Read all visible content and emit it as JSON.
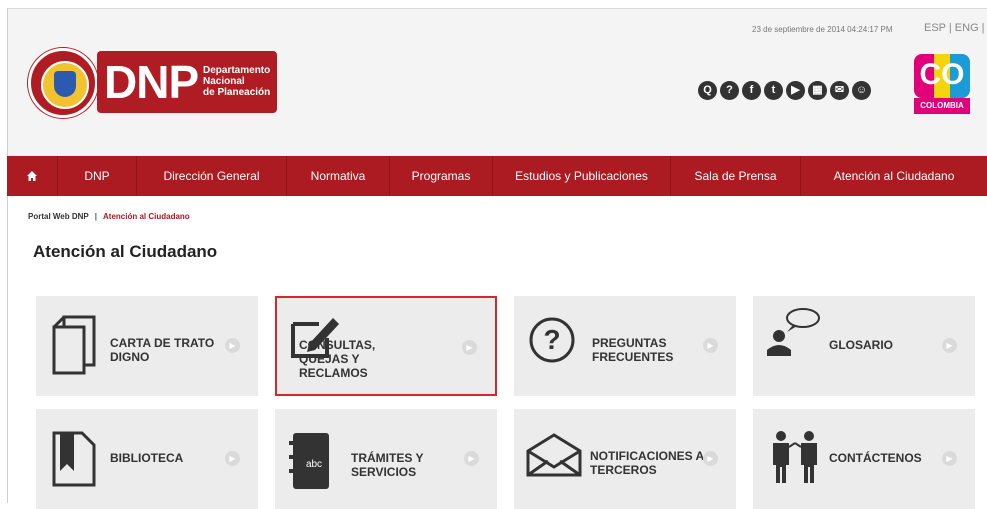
{
  "header": {
    "logo_abbr": "DNP",
    "logo_name": "Departamento\nNacional\nde Planeación",
    "timestamp": "23 de septiembre de 2014 04:24:17 PM",
    "language": "ESP | ENG |",
    "country_logo": "CO",
    "country_word": "COLOMBIA",
    "social_icons": [
      {
        "name": "search-icon",
        "glyph": "Q"
      },
      {
        "name": "help-icon",
        "glyph": "?"
      },
      {
        "name": "facebook-icon",
        "glyph": "f"
      },
      {
        "name": "twitter-icon",
        "glyph": "t"
      },
      {
        "name": "youtube-icon",
        "glyph": "▶"
      },
      {
        "name": "sitemap-icon",
        "glyph": "▦"
      },
      {
        "name": "mail-icon",
        "glyph": "✉"
      },
      {
        "name": "community-icon",
        "glyph": "☺"
      }
    ]
  },
  "nav": {
    "home_icon": "home-icon",
    "items": [
      "DNP",
      "Dirección General",
      "Normativa",
      "Programas",
      "Estudios y Publicaciones",
      "Sala de Prensa",
      "Atención al Ciudadano"
    ]
  },
  "breadcrumb": {
    "root": "Portal Web DNP",
    "separator": "|",
    "current": "Atención al Ciudadano"
  },
  "page_title": "Atención al Ciudadano",
  "cards": [
    {
      "label": "CARTA DE TRATO\nDIGNO",
      "icon": "documents-icon"
    },
    {
      "label": "CONSULTAS,\n        QUEJAS Y\nRECLAMOS",
      "icon": "edit-icon",
      "active": true
    },
    {
      "label": "PREGUNTAS\nFRECUENTES",
      "icon": "question-icon"
    },
    {
      "label": "GLOSARIO",
      "icon": "speech-person-icon"
    },
    {
      "label": "BIBLIOTECA",
      "icon": "bookmark-icon"
    },
    {
      "label": "TRÁMITES Y\nSERVICIOS",
      "icon": "notebook-icon"
    },
    {
      "label": "NOTIFICACIONES A\nTERCEROS",
      "icon": "envelope-icon"
    },
    {
      "label": "CONTÁCTENOS",
      "icon": "people-icon"
    }
  ],
  "card_arrow_glyph": "▶",
  "notebook_text": "abc",
  "colors": {
    "brand_red": "#ab1b21",
    "card_bg": "#ececec",
    "active_border": "#d9262c"
  }
}
